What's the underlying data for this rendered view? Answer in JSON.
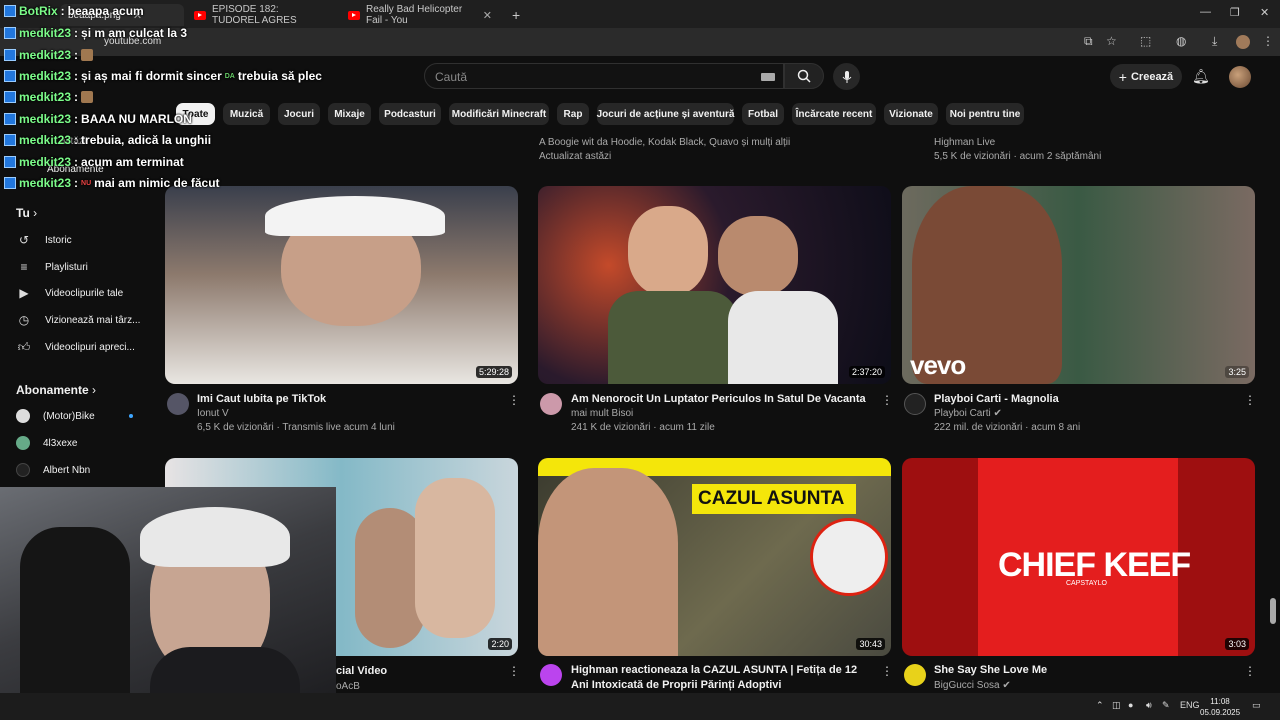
{
  "browser": {
    "tabs": [
      {
        "label": "beaapa.png"
      },
      {
        "label": "EPISODE 182: TUDOREL AGRES"
      },
      {
        "label": "Really Bad Helicopter Fail - You"
      }
    ],
    "new_tab": "+",
    "url": "youtube.com"
  },
  "youtube": {
    "search_placeholder": "Caută",
    "create_label": "Creează",
    "chips": [
      "Toate",
      "Muzică",
      "Jocuri",
      "Mixaje",
      "Podcasturi",
      "Modificări Minecraft",
      "Rap",
      "Jocuri de acțiune și aventură",
      "Fotbal",
      "Încărcate recent",
      "Vizionate",
      "Noi pentru tine"
    ]
  },
  "sidebar": {
    "partial_top": "astăzi",
    "abonamente_top": "Abonamente",
    "tu_header": "Tu",
    "tu_items": [
      "Istoric",
      "Playlisturi",
      "Videoclipurile tale",
      "Vizionează mai târz...",
      "Videoclipuri apreci..."
    ],
    "subs_header": "Abonamente",
    "subs": [
      "(Motor)Bike",
      "4l3xexe",
      "Albert Nbn"
    ]
  },
  "top_row_partial": [
    {
      "line1": "A Boogie wit da Hoodie, Kodak Black, Quavo și mulți alții",
      "line2": "Actualizat astăzi"
    },
    {
      "line1": "Highman Live",
      "line2": "5,5 K de vizionări · acum 2 săptămâni"
    }
  ],
  "videos": [
    {
      "title": "Imi Caut Iubita pe TikTok",
      "channel": "Ionut V",
      "meta": "6,5 K de vizionări · Transmis live acum 4 luni",
      "duration": "5:29:28"
    },
    {
      "title": "Am Nenorocit Un Luptator Periculos In Satul De Vacanta",
      "channel": "mai mult Bisoi",
      "meta": "241 K de vizionări · acum 11 zile",
      "duration": "2:37:20"
    },
    {
      "title": "Playboi Carti - Magnolia",
      "channel": "Playboi Carti",
      "meta": "222 mil. de vizionări · acum 8 ani",
      "duration": "3:25",
      "thumb_text": "vevo"
    },
    {
      "title": "cial Video",
      "channel": "oAcB",
      "duration": "2:20"
    },
    {
      "title": "Highman reactioneaza la CAZUL ASUNTA | Fetița de 12 Ani Intoxicată de Proprii Părinți Adoptivi",
      "duration": "30:43",
      "thumb_text": "CAZUL ASUNTA"
    },
    {
      "title": "She Say She Love Me",
      "channel": "BigGucci Sosa",
      "duration": "3:03",
      "thumb_text": "CHIEF KEEF",
      "thumb_sub": "CAPSTAYLO"
    }
  ],
  "chat": [
    {
      "user": "BotRix",
      "msg": "beaapa acum"
    },
    {
      "user": "medkit23",
      "msg": "și m am culcat la 3"
    },
    {
      "user": "medkit23",
      "msg": ""
    },
    {
      "user": "medkit23",
      "msg": "și aș mai fi dormit sincer",
      "tag": "DA",
      "msg2": "trebuia să plec"
    },
    {
      "user": "medkit23",
      "msg": ""
    },
    {
      "user": "medkit23",
      "msg": "BAAA NU MARLON"
    },
    {
      "user": "medkit23",
      "msg": "trebuia, adică la unghii"
    },
    {
      "user": "medkit23",
      "msg": "acum am terminat"
    },
    {
      "user": "medkit23",
      "tag": "NU",
      "msg": "mai am nimic de făcut"
    }
  ],
  "taskbar": {
    "lang": "ENG",
    "time": "11:08",
    "date": "05.09.2025"
  }
}
